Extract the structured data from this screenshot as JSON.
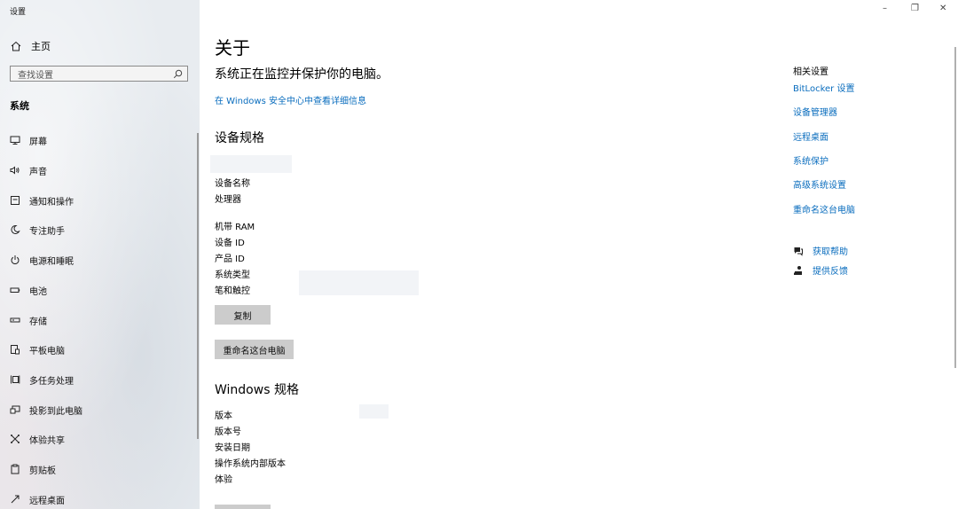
{
  "window": {
    "title": "设置",
    "minimize": "–",
    "restore": "❐",
    "close": "✕"
  },
  "sidebar": {
    "home_label": "主页",
    "search_placeholder": "查找设置",
    "section": "系统",
    "items": [
      {
        "label": "屏幕",
        "icon": "monitor-icon"
      },
      {
        "label": "声音",
        "icon": "speaker-icon"
      },
      {
        "label": "通知和操作",
        "icon": "notification-icon"
      },
      {
        "label": "专注助手",
        "icon": "moon-icon"
      },
      {
        "label": "电源和睡眠",
        "icon": "power-icon"
      },
      {
        "label": "电池",
        "icon": "battery-icon"
      },
      {
        "label": "存储",
        "icon": "storage-icon"
      },
      {
        "label": "平板电脑",
        "icon": "tablet-icon"
      },
      {
        "label": "多任务处理",
        "icon": "multitask-icon"
      },
      {
        "label": "投影到此电脑",
        "icon": "project-icon"
      },
      {
        "label": "体验共享",
        "icon": "share-icon"
      },
      {
        "label": "剪贴板",
        "icon": "clipboard-icon"
      },
      {
        "label": "远程桌面",
        "icon": "remote-desktop-icon"
      }
    ]
  },
  "main": {
    "title": "关于",
    "status": "系统正在监控并保护你的电脑。",
    "security_link": "在 Windows 安全中心中查看详细信息",
    "device_specs": {
      "heading": "设备规格",
      "labels": [
        "设备名称",
        "处理器",
        "机带 RAM",
        "设备 ID",
        "产品 ID",
        "系统类型",
        "笔和触控"
      ],
      "copy_button": "复制",
      "rename_button": "重命名这台电脑"
    },
    "windows_specs": {
      "heading": "Windows 规格",
      "labels": [
        "版本",
        "版本号",
        "安装日期",
        "操作系统内部版本",
        "体验"
      ]
    }
  },
  "related": {
    "title": "相关设置",
    "links": [
      "BitLocker 设置",
      "设备管理器",
      "远程桌面",
      "系统保护",
      "高级系统设置",
      "重命名这台电脑"
    ],
    "help": "获取帮助",
    "feedback": "提供反馈"
  },
  "colors": {
    "link": "#0a6dbe",
    "button": "#cccccc"
  }
}
